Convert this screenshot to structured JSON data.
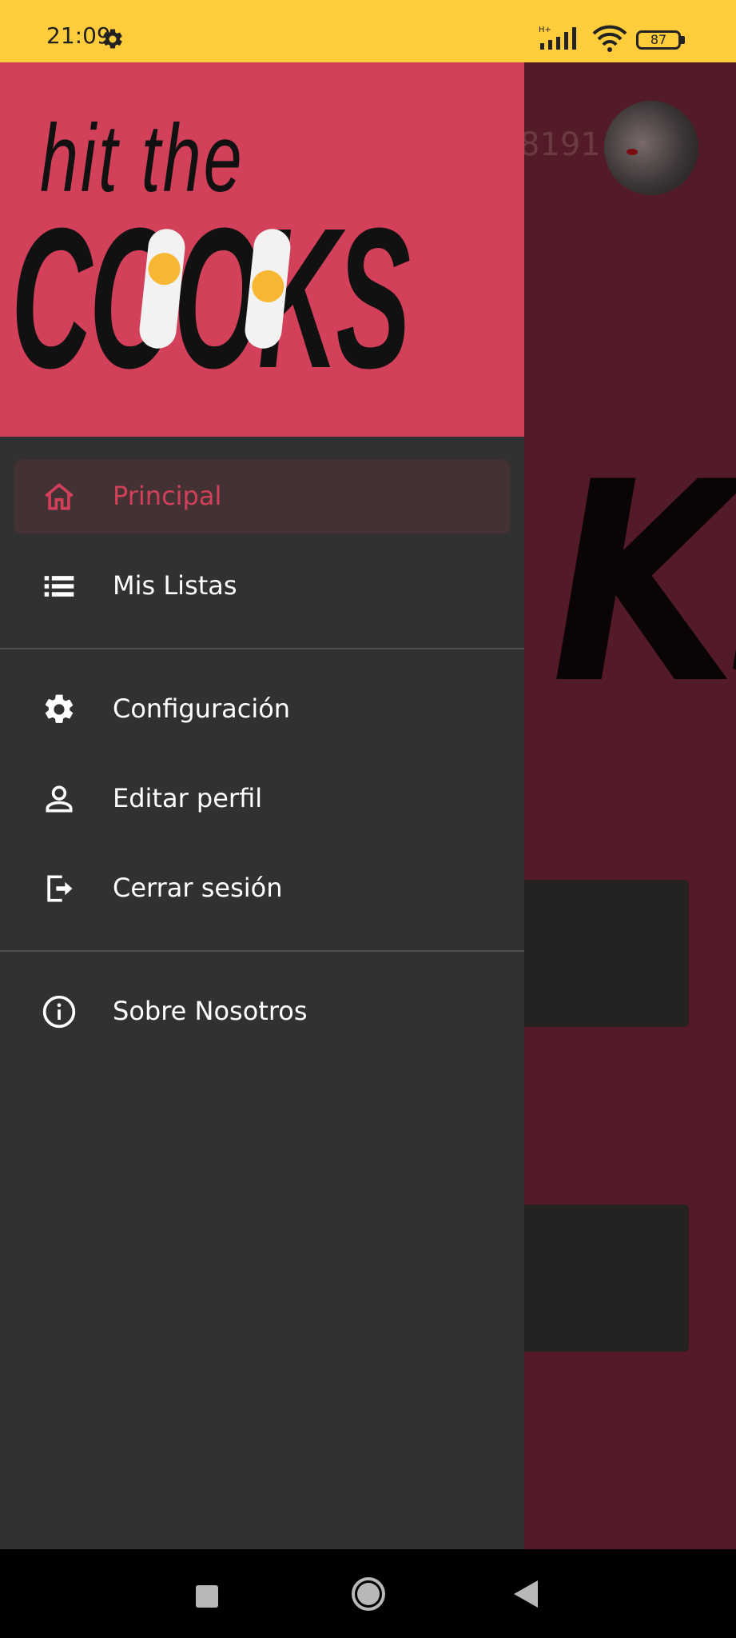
{
  "status_bar": {
    "time": "21:09",
    "network_type": "H+",
    "battery": "87",
    "icons": [
      "gear-icon",
      "signal-icon",
      "wifi-icon",
      "battery-icon"
    ]
  },
  "background_app": {
    "partial_number": "8191",
    "partial_logo_text": "KS"
  },
  "drawer": {
    "logo_top": "hit the",
    "logo_main": "COOKS",
    "items": [
      {
        "label": "Principal",
        "icon": "home-icon",
        "active": true
      },
      {
        "label": "Mis Listas",
        "icon": "list-icon",
        "active": false
      },
      {
        "label": "Configuración",
        "icon": "gear-icon",
        "active": false
      },
      {
        "label": "Editar perfil",
        "icon": "person-icon",
        "active": false
      },
      {
        "label": "Cerrar sesión",
        "icon": "logout-icon",
        "active": false
      },
      {
        "label": "Sobre Nosotros",
        "icon": "info-icon",
        "active": false
      }
    ]
  },
  "colors": {
    "status_bar": "#FFCD3C",
    "drawer_header": "#D2405A",
    "drawer_bg": "#313131",
    "active_item_bg": "#433134",
    "accent": "#D2405A",
    "scrim_bg": "#531B27"
  },
  "nav_bar": {
    "buttons": [
      "recents-button",
      "home-button",
      "back-button"
    ]
  }
}
